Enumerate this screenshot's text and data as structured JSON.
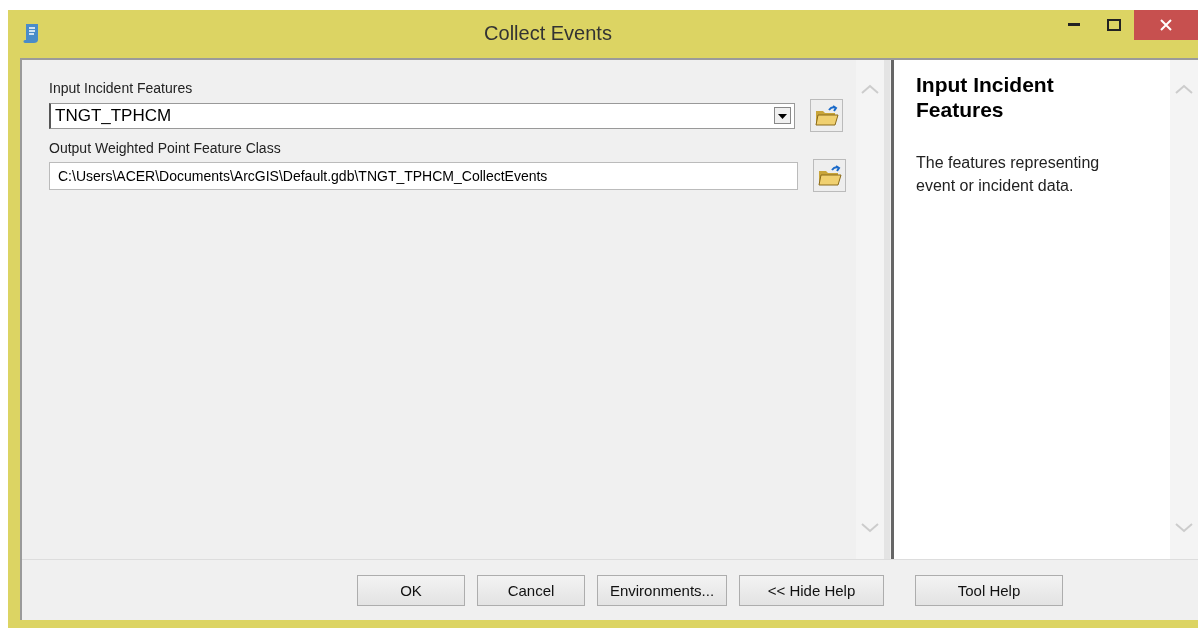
{
  "window": {
    "title": "Collect Events"
  },
  "parameters": [
    {
      "kind": "dropdown",
      "label": "Input Incident Features",
      "value": "TNGT_TPHCM"
    },
    {
      "kind": "text",
      "label": "Output Weighted Point Feature Class",
      "value": "C:\\Users\\ACER\\Documents\\ArcGIS\\Default.gdb\\TNGT_TPHCM_CollectEvents"
    }
  ],
  "help": {
    "title": "Input Incident Features",
    "text": "The features representing event or incident data."
  },
  "buttons": [
    "OK",
    "Cancel",
    "Environments...",
    "<< Hide Help",
    "Tool Help"
  ]
}
